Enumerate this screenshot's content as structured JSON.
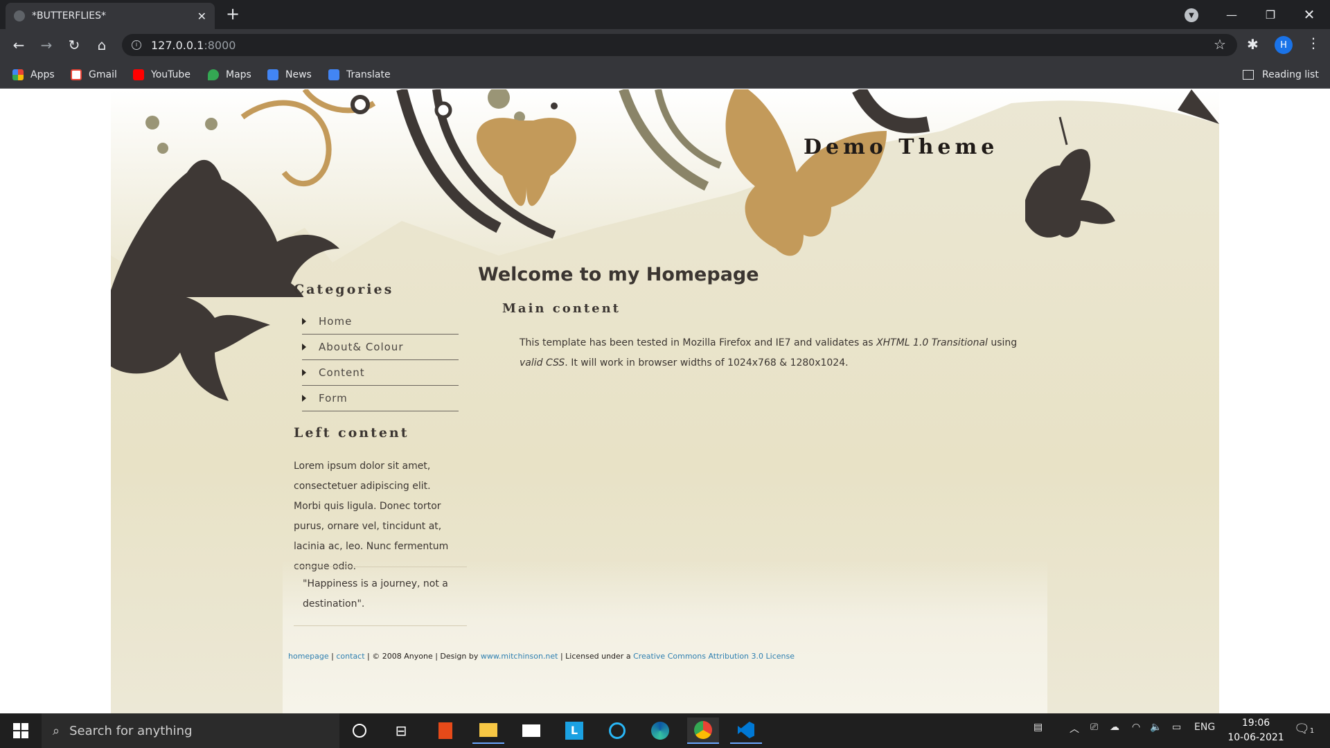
{
  "browser": {
    "tab_title": "*BUTTERFLIES*",
    "url_host": "127.0.0.1",
    "url_port": ":8000",
    "avatar_initial": "H",
    "bookmarks": [
      "Apps",
      "Gmail",
      "YouTube",
      "Maps",
      "News",
      "Translate"
    ],
    "reading_list": "Reading list"
  },
  "site": {
    "title": "Demo Theme",
    "categories_heading": "Categories",
    "menu": [
      "Home",
      "About& Colour",
      "Content",
      "Form"
    ],
    "left_heading": "Left content",
    "left_text": "Lorem ipsum dolor sit amet, consectetuer adipiscing elit. Morbi quis ligula. Donec tortor purus, ornare vel, tincidunt at, lacinia ac, leo. Nunc fermentum congue odio.",
    "quote": "\"Happiness is a journey, not a destination\".",
    "welcome": "Welcome to my Homepage",
    "main_heading": "Main content",
    "main_text_1": "This template has been tested in Mozilla Firefox and IE7 and validates as ",
    "main_text_xhtml": "XHTML 1.0 Transitional",
    "main_text_2": " using ",
    "main_text_valid": "valid CSS",
    "main_text_3": ". It will work in browser widths of 1024x768 & 1280x1024.",
    "footer": {
      "homepage": "homepage",
      "sep1": " | ",
      "contact": "contact",
      "copyright": " | © 2008 Anyone | Design by ",
      "design_link": "www.mitchinson.net",
      "licensed": " | Licensed under a ",
      "license_link": "Creative Commons Attribution 3.0 License"
    }
  },
  "taskbar": {
    "search_placeholder": "Search for anything",
    "lang": "ENG",
    "time": "19:06",
    "date": "10-06-2021",
    "notification_count": "1"
  },
  "colors": {
    "chrome_dark": "#202124",
    "site_bg": "#e8e2c6",
    "butterfly_dark": "#3e3835",
    "butterfly_gold": "#c39a5a",
    "link": "#2e7fb0"
  }
}
